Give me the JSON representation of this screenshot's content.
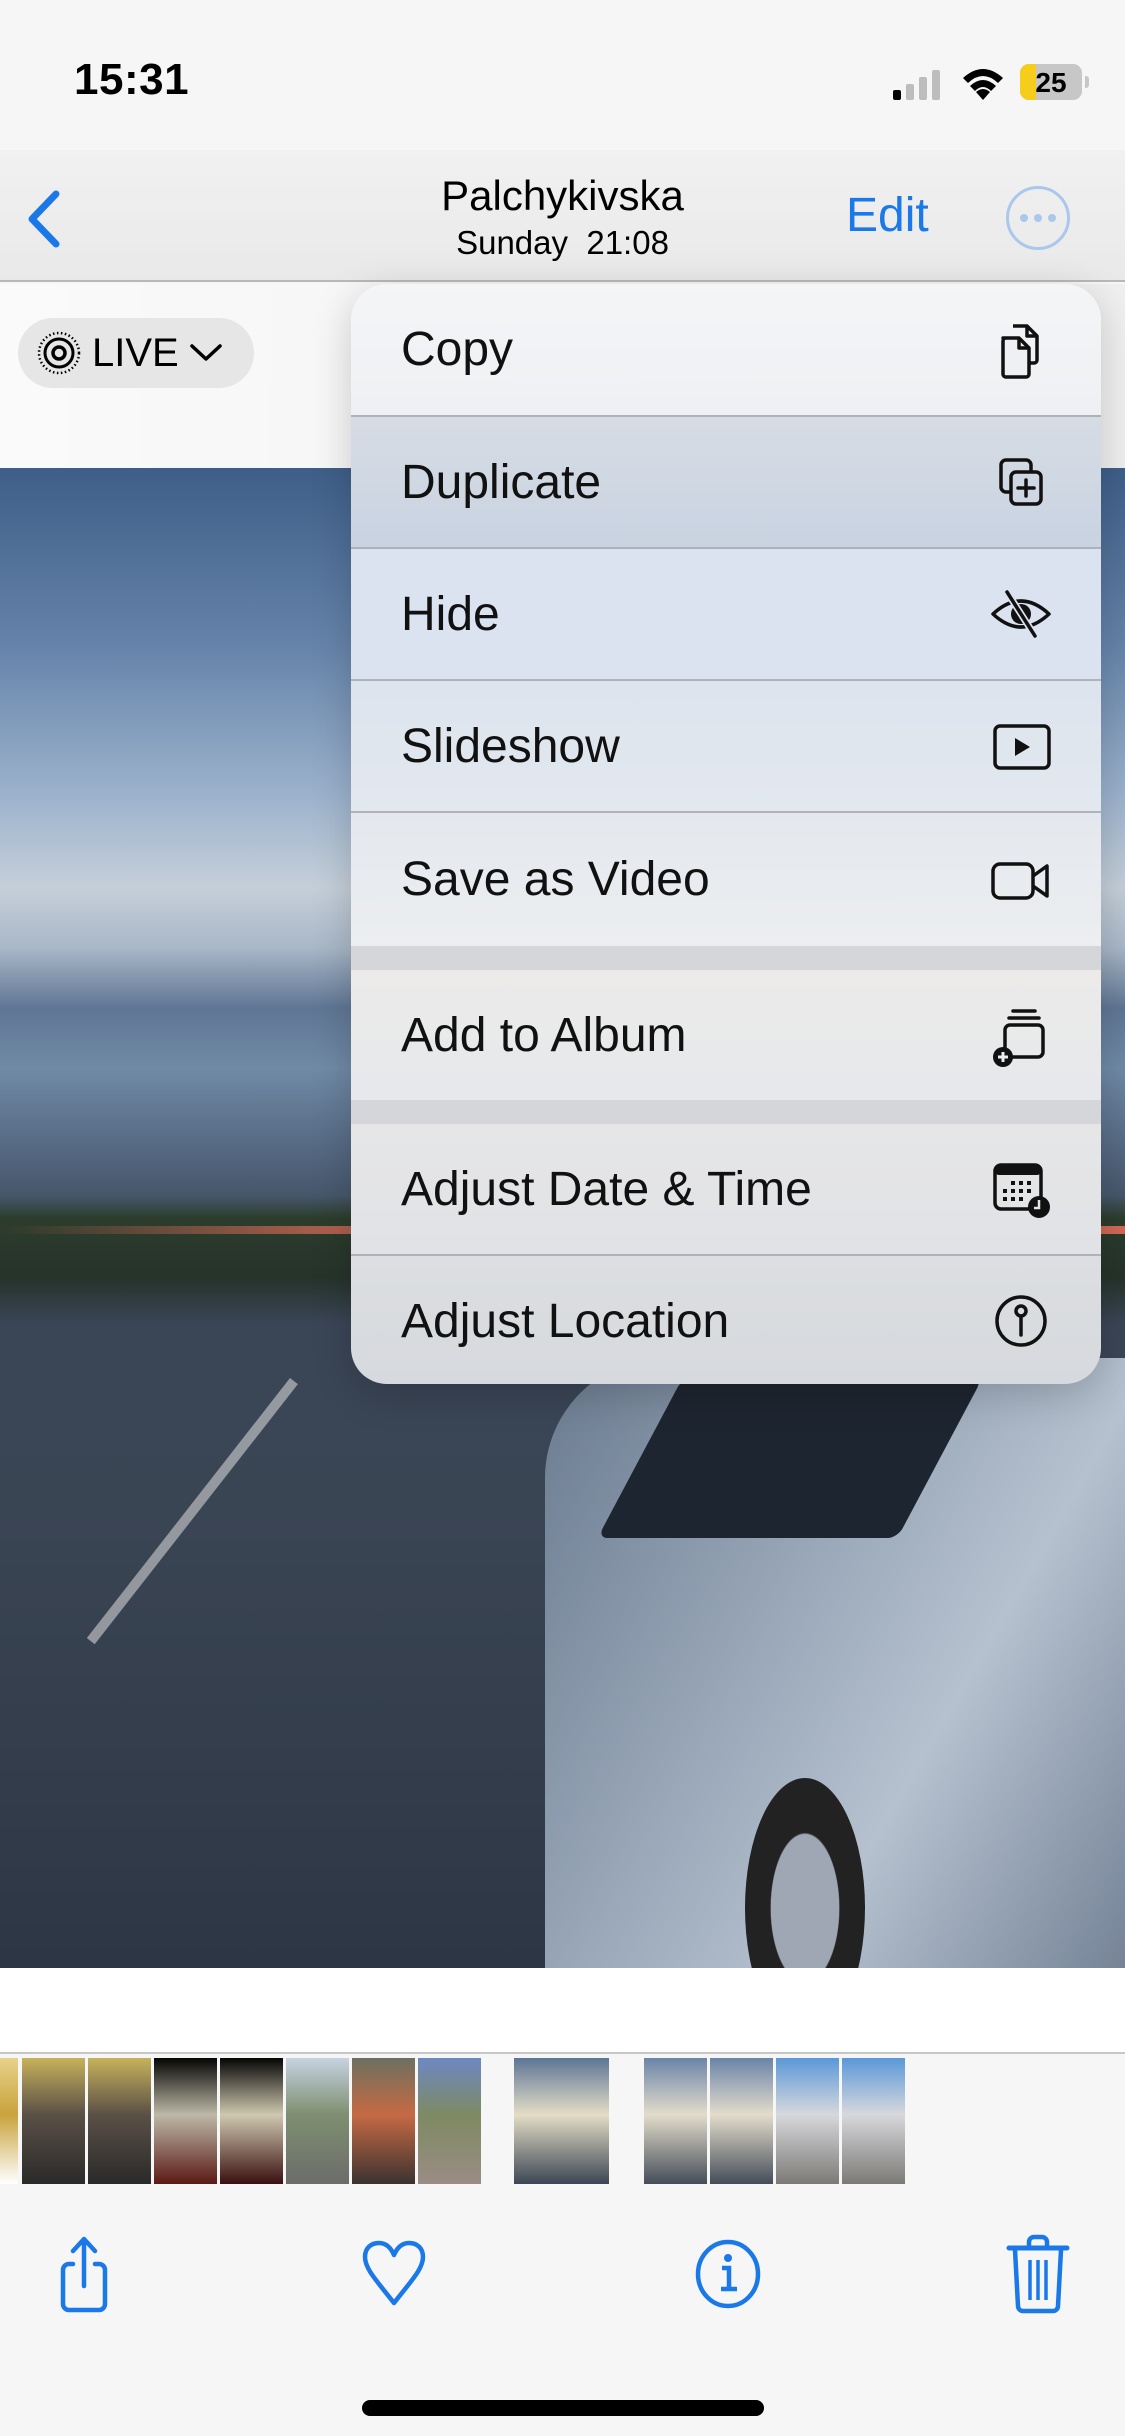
{
  "status_bar": {
    "time": "15:31",
    "battery_level": "25",
    "battery_percent": 25,
    "signal_bars_active": 1,
    "signal_bars_total": 4,
    "icons": [
      "cellular-signal-icon",
      "wifi-icon",
      "battery-icon"
    ]
  },
  "nav": {
    "back_icon": "chevron-left-icon",
    "title": "Palchykivska",
    "subtitle": "Sunday  21:08",
    "edit_label": "Edit",
    "more_icon": "ellipsis-circle-icon"
  },
  "live_button": {
    "icon": "live-photo-icon",
    "label": "LIVE",
    "chevron": "chevron-down-icon"
  },
  "context_menu": {
    "groups": [
      {
        "items": [
          {
            "label": "Copy",
            "icon": "copy-icon",
            "highlighted": false
          },
          {
            "label": "Duplicate",
            "icon": "duplicate-icon",
            "highlighted": true
          },
          {
            "label": "Hide",
            "icon": "eye-slash-icon",
            "highlighted": false
          },
          {
            "label": "Slideshow",
            "icon": "play-rectangle-icon",
            "highlighted": false
          },
          {
            "label": "Save as Video",
            "icon": "video-camera-icon",
            "highlighted": false
          }
        ]
      },
      {
        "items": [
          {
            "label": "Add to Album",
            "icon": "add-to-album-icon",
            "highlighted": false
          }
        ]
      },
      {
        "items": [
          {
            "label": "Adjust Date & Time",
            "icon": "calendar-clock-icon",
            "highlighted": false
          },
          {
            "label": "Adjust Location",
            "icon": "location-pin-circle-icon",
            "highlighted": false
          }
        ]
      }
    ]
  },
  "filmstrip": {
    "thumbnails": [
      {
        "desc": "partial food photo",
        "colors": [
          "#e6d28a",
          "#c9a33c",
          "#ffffff"
        ]
      },
      {
        "desc": "restaurant table",
        "colors": [
          "#c7b25a",
          "#5a5046",
          "#2a2a2a"
        ]
      },
      {
        "desc": "restaurant table",
        "colors": [
          "#c7b25a",
          "#5a5046",
          "#2a2a2a"
        ]
      },
      {
        "desc": "glowing lantern",
        "colors": [
          "#050505",
          "#bdb8a8",
          "#5a1a14"
        ]
      },
      {
        "desc": "glowing lantern",
        "colors": [
          "#050505",
          "#cfc8b0",
          "#3a1010"
        ]
      },
      {
        "desc": "sky and tree",
        "colors": [
          "#c6d3e2",
          "#7e8f70",
          "#6c6c6a"
        ]
      },
      {
        "desc": "skewers on grill",
        "colors": [
          "#6b7060",
          "#c56a44",
          "#3b3230"
        ]
      },
      {
        "desc": "person on path",
        "colors": [
          "#6d88c2",
          "#7d8a63",
          "#9b8c84"
        ]
      },
      {
        "desc": "sunset parking lot",
        "colors": [
          "#5d7596",
          "#e4ddc6",
          "#3c4654"
        ],
        "current": true
      },
      {
        "desc": "car at sunset",
        "colors": [
          "#6a84a8",
          "#e3dccb",
          "#444d59"
        ]
      },
      {
        "desc": "car at sunset",
        "colors": [
          "#6a84a8",
          "#e3dccb",
          "#444d59"
        ]
      },
      {
        "desc": "silver car front",
        "colors": [
          "#5a98d8",
          "#d7d8dc",
          "#7c7a76"
        ]
      },
      {
        "desc": "silver car front",
        "colors": [
          "#5a98d8",
          "#d7d8dc",
          "#7c7a76"
        ]
      }
    ]
  },
  "toolbar": {
    "buttons": [
      {
        "name": "share-button",
        "icon": "share-icon"
      },
      {
        "name": "favorite-button",
        "icon": "heart-icon"
      },
      {
        "name": "info-button",
        "icon": "info-circle-icon"
      },
      {
        "name": "delete-button",
        "icon": "trash-icon"
      }
    ]
  },
  "colors": {
    "accent": "#1a78e8",
    "menu_highlight": "#cdd5e0",
    "battery_low": "#f7cd1c"
  }
}
